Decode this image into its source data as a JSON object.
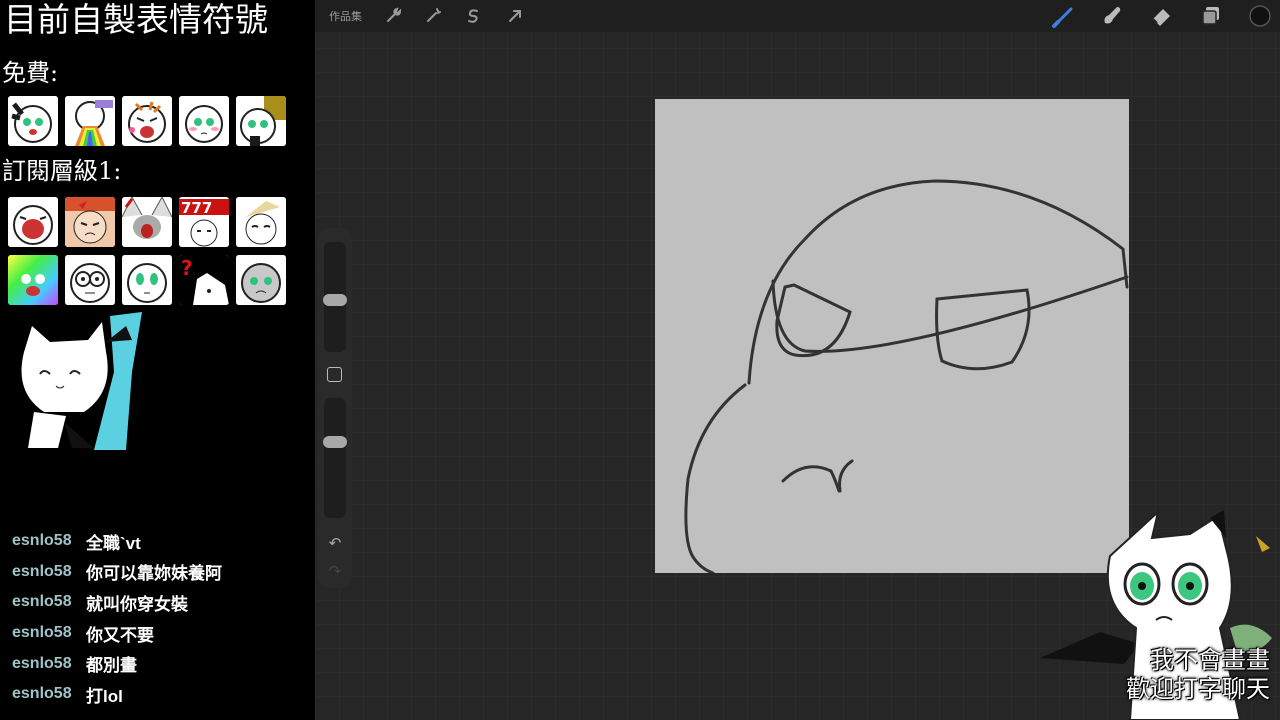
{
  "overlay": {
    "title": "目前自製表情符號",
    "free_label": "免費:",
    "tier1_label": "訂閱層級1:"
  },
  "chat": {
    "messages": [
      {
        "user": "esnlo58",
        "text": "全職`vt"
      },
      {
        "user": "esnlo58",
        "text": "你可以靠妳妹養阿"
      },
      {
        "user": "esnlo58",
        "text": "就叫你穿女裝"
      },
      {
        "user": "esnlo58",
        "text": "你又不要"
      },
      {
        "user": "esnlo58",
        "text": "都別畫"
      },
      {
        "user": "esnlo58",
        "text": "打lol"
      }
    ]
  },
  "procreate": {
    "gallery_label": "作品集",
    "toolbar_icons": [
      "wrench-icon",
      "magic-wand-icon",
      "selection-icon",
      "transform-arrow-icon"
    ],
    "tool_icons": [
      "brush-icon",
      "smudge-icon",
      "eraser-icon",
      "layers-icon",
      "color-icon"
    ],
    "undo_symbol": "↶",
    "redo_symbol": "↷"
  },
  "caption": {
    "line1": "我不會畫畫",
    "line2": "歡迎打字聊天"
  },
  "colors": {
    "chat_user": "#9fc3c8",
    "brush_active": "#3b7fe0",
    "canvas_bg": "#c0c0c0"
  }
}
